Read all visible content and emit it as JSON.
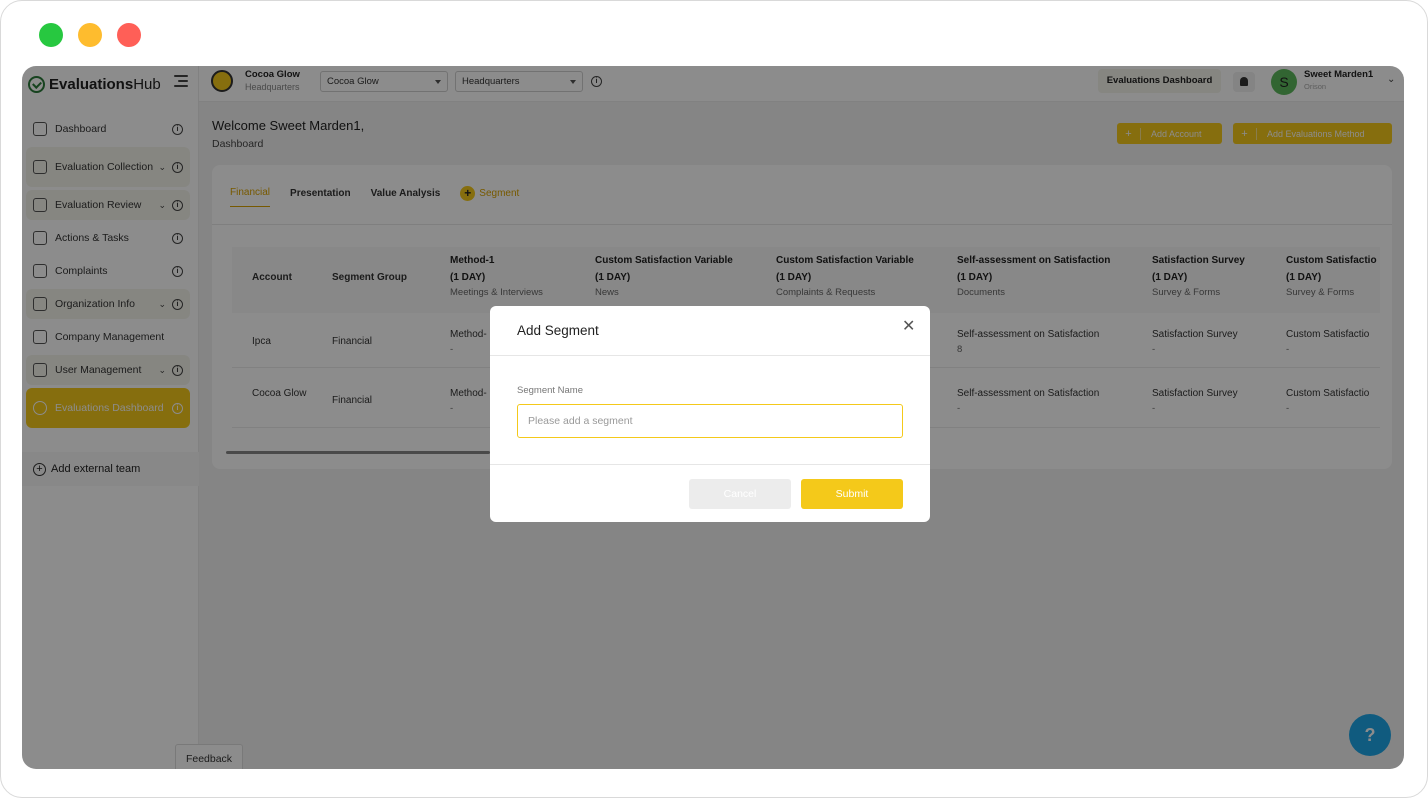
{
  "window": {
    "controls": [
      "green",
      "yellow",
      "red"
    ]
  },
  "brand": {
    "name_bold": "Evaluations",
    "name_rest": "Hub"
  },
  "sidebar": {
    "items": [
      {
        "label": "Dashboard",
        "icon": "home-icon",
        "chevron": false
      },
      {
        "label": "Evaluation Collection",
        "icon": "search-doc-icon",
        "chevron": true
      },
      {
        "label": "Evaluation Review",
        "icon": "gear-icon",
        "chevron": true
      },
      {
        "label": "Actions & Tasks",
        "icon": "list-icon",
        "chevron": false
      },
      {
        "label": "Complaints",
        "icon": "chat-icon",
        "chevron": false
      },
      {
        "label": "Organization Info",
        "icon": "chart-icon",
        "chevron": true
      },
      {
        "label": "Company Management",
        "icon": "building-icon",
        "chevron": false
      },
      {
        "label": "User Management",
        "icon": "gear-icon",
        "chevron": true
      },
      {
        "label": "Evaluations Dashboard",
        "icon": "gear-icon",
        "chevron": false
      }
    ],
    "add_team": "Add external team"
  },
  "topbar": {
    "org_name": "Cocoa Glow",
    "org_sub": "Headquarters",
    "company_select": "Cocoa Glow",
    "location_select": "Headquarters",
    "eval_dashboard": "Evaluations Dashboard",
    "user_initial": "S",
    "user_name": "Sweet Marden1",
    "user_sub": "Orison"
  },
  "main": {
    "welcome": "Welcome Sweet Marden1,",
    "breadcrumb": "Dashboard",
    "add_account": "Add Account",
    "add_method": "Add Evaluations Method",
    "tabs": [
      "Financial",
      "Presentation",
      "Value Analysis"
    ],
    "add_segment": "Segment"
  },
  "table": {
    "headers": [
      {
        "l1": "Account"
      },
      {
        "l1": "Segment Group"
      },
      {
        "l1": "Method-1",
        "l2": "(1 DAY)",
        "l3": "Meetings & Interviews"
      },
      {
        "l1": "Custom Satisfaction Variable",
        "l2": "(1 DAY)",
        "l3": "News"
      },
      {
        "l1": "Custom Satisfaction Variable",
        "l2": "(1 DAY)",
        "l3": "Complaints & Requests"
      },
      {
        "l1": "Self-assessment on Satisfaction",
        "l2": "(1 DAY)",
        "l3": "Documents"
      },
      {
        "l1": "Satisfaction Survey",
        "l2": "(1 DAY)",
        "l3": "Survey & Forms"
      },
      {
        "l1": "Custom Satisfactio",
        "l2": "(1 DAY)",
        "l3": "Survey & Forms"
      }
    ],
    "rows": [
      {
        "account": "Ipca",
        "group": "Financial",
        "c3": "Method-",
        "c3s": "-",
        "c6": "Self-assessment on Satisfaction",
        "c6s": "8",
        "c7": "Satisfaction Survey",
        "c7s": "-",
        "c8": "Custom Satisfactio",
        "c8s": "-"
      },
      {
        "account": "Cocoa Glow",
        "group": "Financial",
        "c3": "Method-",
        "c3s": "-",
        "c6": "Self-assessment on Satisfaction",
        "c6s": "-",
        "c7": "Satisfaction Survey",
        "c7s": "-",
        "c8": "Custom Satisfactio",
        "c8s": "-"
      }
    ]
  },
  "modal": {
    "title": "Add Segment",
    "field_label": "Segment Name",
    "placeholder": "Please add a segment",
    "value": "",
    "cancel": "Cancel",
    "submit": "Submit"
  },
  "feedback": "Feedback",
  "help": "?",
  "colors": {
    "accent": "#f4c91a",
    "help": "#1ea7e8"
  }
}
